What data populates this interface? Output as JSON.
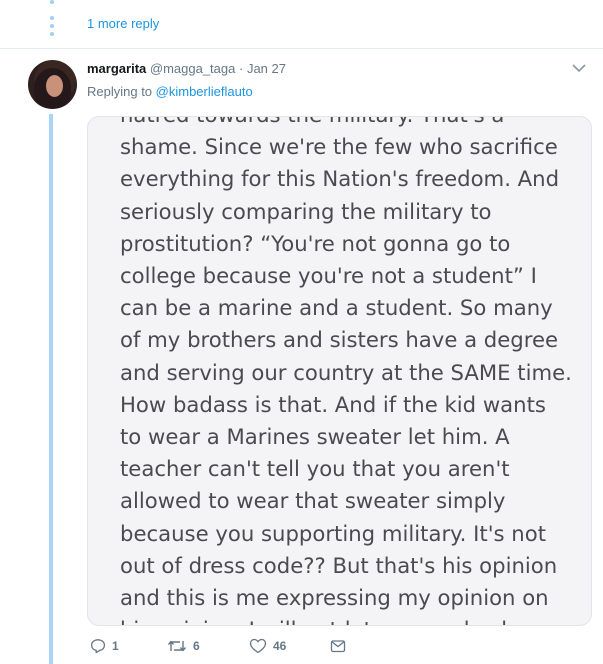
{
  "thread": {
    "more_reply": "1 more reply"
  },
  "tweet": {
    "name": "margarita",
    "handle": "@magga_taga",
    "separator": "·",
    "date": "Jan 27",
    "replying_prefix": "Replying to ",
    "replying_to": "@kimberlieflauto",
    "image_text_lines": [
      "hatred towards the military. That's a",
      "shame. Since we're the few who sacrifice",
      "everything for this Nation's freedom. And",
      "seriously comparing the military to",
      "prostitution? “You're not gonna go to",
      "college because you're not a student” I",
      "can be a marine and a student. So many",
      "of my brothers and sisters have a degree",
      "and serving our country at the SAME time.",
      "How badass is that. And if the kid wants",
      "to wear a Marines sweater let him. A",
      "teacher can't tell you that you aren't",
      "allowed to wear that sweater simply",
      "because you supporting military. It's not",
      "out of dress code?? But that's his opinion",
      "and this is me expressing my opinion on",
      "his opinion. I will not let anyone bash on"
    ],
    "actions": {
      "reply_count": "1",
      "retweet_count": "6",
      "like_count": "46"
    }
  },
  "colors": {
    "link": "#1b95e0",
    "thread_line": "#a8d5f5",
    "muted": "#657786"
  },
  "icons": [
    "chevron-down-icon",
    "reply-icon",
    "retweet-icon",
    "like-icon",
    "message-icon"
  ]
}
